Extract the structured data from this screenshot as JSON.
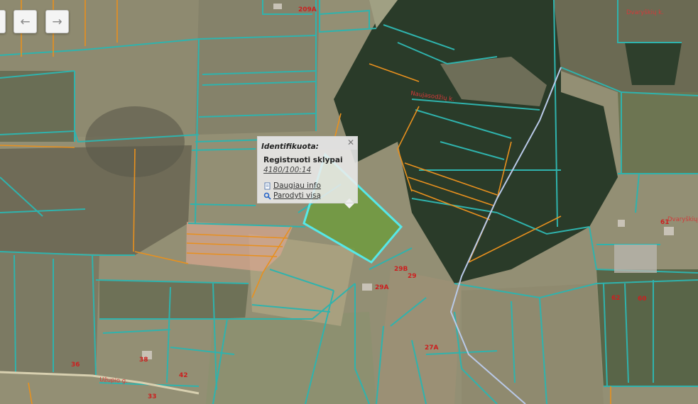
{
  "nav": {
    "back_icon": "arrow-left-icon",
    "forward_icon": "arrow-right-icon",
    "back_glyph": "←",
    "forward_glyph": "→"
  },
  "popup": {
    "title": "Identifikuota:",
    "close_glyph": "✕",
    "layer": "Registruoti sklypai",
    "parcel": "4180/100:14",
    "more_info": "Daugiau info",
    "show_all": "Parodyti visą"
  },
  "map_labels": {
    "place_a": "Dvaryškių k.",
    "place_b": "Naujasodžių k.",
    "place_c": "Dvaryškių k.",
    "street": "Užupio g.",
    "house_209a": "209A",
    "house_29b": "29B",
    "house_29": "29",
    "house_29a": "29A",
    "house_27a": "27A",
    "house_62": "62",
    "house_60": "60",
    "house_61": "61",
    "house_36": "36",
    "house_38": "38",
    "house_42": "42",
    "house_33": "33"
  },
  "colors": {
    "parcel_outline": "#2fb3ad",
    "selected_outline": "#56e8e8",
    "orange_lines": "#e8901e",
    "forest": "#263a26",
    "field": "#9a9577"
  }
}
